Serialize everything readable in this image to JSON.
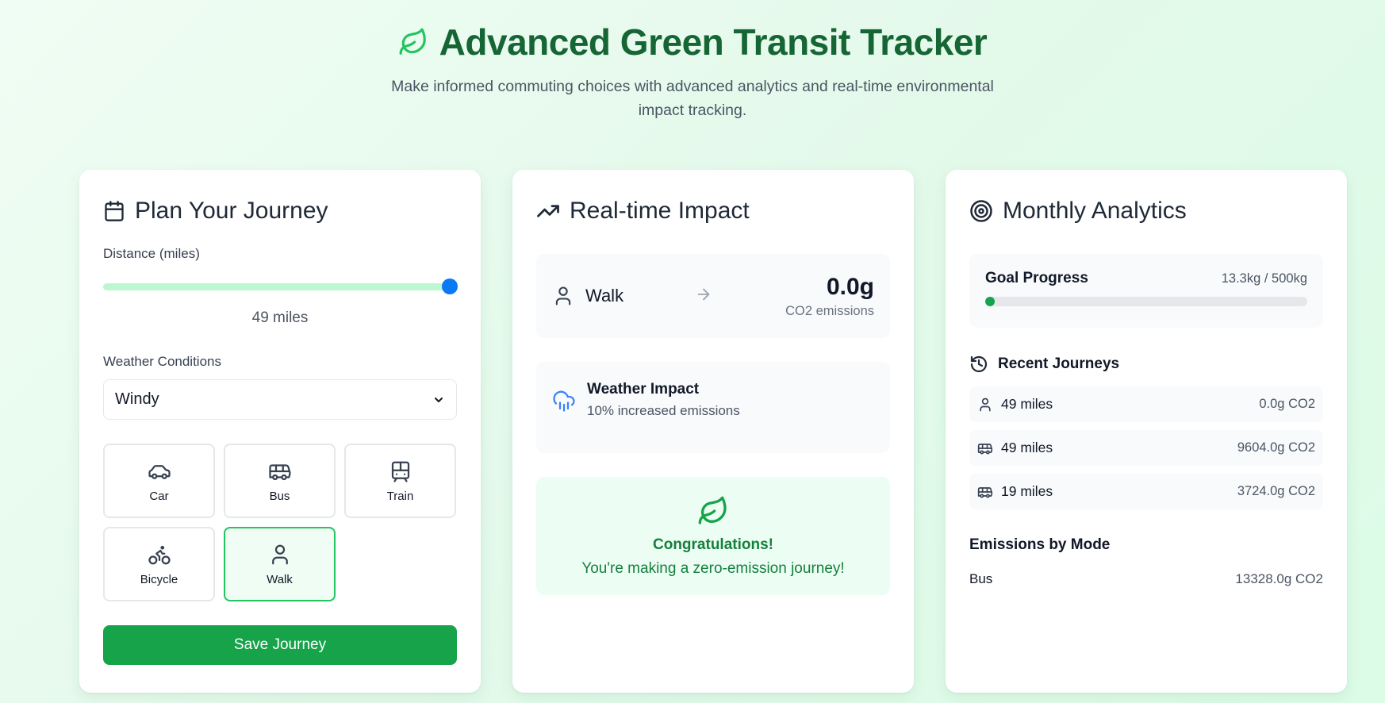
{
  "header": {
    "title": "Advanced Green Transit Tracker",
    "subtitle": "Make informed commuting choices with advanced analytics and real-time environmental impact tracking.",
    "logo_icon": "leaf-icon",
    "accent_color": "#166534"
  },
  "plan": {
    "title": "Plan Your Journey",
    "distance_label": "Distance (miles)",
    "distance_value": 49,
    "distance_max": 50,
    "distance_display": "49 miles",
    "weather_label": "Weather Conditions",
    "weather_selected": "Windy",
    "modes": [
      {
        "label": "Car",
        "icon": "car-icon",
        "active": false
      },
      {
        "label": "Bus",
        "icon": "bus-icon",
        "active": false
      },
      {
        "label": "Train",
        "icon": "train-icon",
        "active": false
      },
      {
        "label": "Bicycle",
        "icon": "bicycle-icon",
        "active": false
      },
      {
        "label": "Walk",
        "icon": "walk-icon",
        "active": true
      }
    ],
    "save_label": "Save Journey"
  },
  "impact": {
    "title": "Real-time Impact",
    "mode": "Walk",
    "value": "0.0g",
    "unit": "CO2 emissions",
    "weather_title": "Weather Impact",
    "weather_desc": "10% increased emissions",
    "congrats_title": "Congratulations!",
    "congrats_text": "You're making a zero-emission journey!"
  },
  "analytics": {
    "title": "Monthly Analytics",
    "goal_label": "Goal Progress",
    "goal_value": "13.3kg / 500kg",
    "goal_fraction": 0.0266,
    "recent_title": "Recent Journeys",
    "journeys": [
      {
        "icon": "walk-icon",
        "distance": "49 miles",
        "emissions": "0.0g CO2"
      },
      {
        "icon": "bus-icon",
        "distance": "49 miles",
        "emissions": "9604.0g CO2"
      },
      {
        "icon": "bus-icon",
        "distance": "19 miles",
        "emissions": "3724.0g CO2"
      }
    ],
    "mode_title": "Emissions by Mode",
    "modes": [
      {
        "name": "Bus",
        "value": "13328.0g CO2"
      }
    ]
  }
}
